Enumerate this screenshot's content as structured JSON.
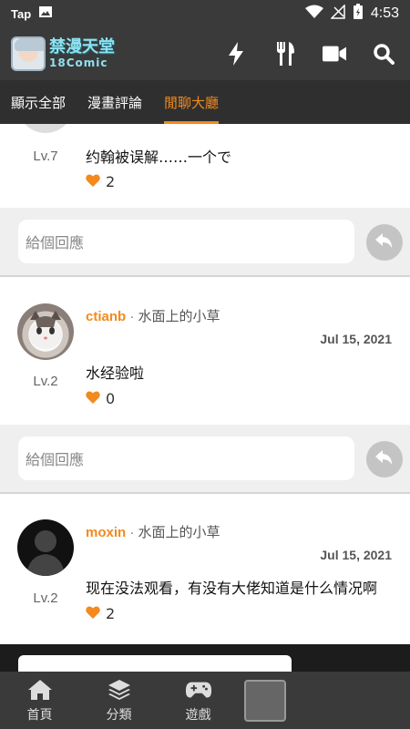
{
  "status_bar": {
    "left_label": "Tap",
    "time": "4:53"
  },
  "app": {
    "logo_line1": "禁漫天堂",
    "logo_line2": "18Comic"
  },
  "tabs": [
    {
      "label": "顯示全部",
      "active": false
    },
    {
      "label": "漫畫評論",
      "active": false
    },
    {
      "label": "閒聊大廳",
      "active": true
    }
  ],
  "reply_placeholder": "給個回應",
  "comments": [
    {
      "level": "Lv.7",
      "content": "约翰被误解……一个で",
      "likes": "2"
    },
    {
      "username": "ctianb",
      "separator": "·",
      "user_title": "水面上的小草",
      "date": "Jul 15, 2021",
      "level": "Lv.2",
      "content": "水经验啦",
      "likes": "0"
    },
    {
      "username": "moxin",
      "separator": "·",
      "user_title": "水面上的小草",
      "date": "Jul 15, 2021",
      "level": "Lv.2",
      "content": "现在没法观看，有没有大佬知道是什么情况啊",
      "likes": "2"
    }
  ],
  "bottom_nav": [
    {
      "label": "首頁",
      "icon": "home-icon"
    },
    {
      "label": "分類",
      "icon": "layers-icon"
    },
    {
      "label": "遊戲",
      "icon": "gamepad-icon"
    }
  ],
  "colors": {
    "accent": "#f28a1e",
    "bar": "#3a3a3a",
    "tabbar": "#2f2f2f"
  }
}
